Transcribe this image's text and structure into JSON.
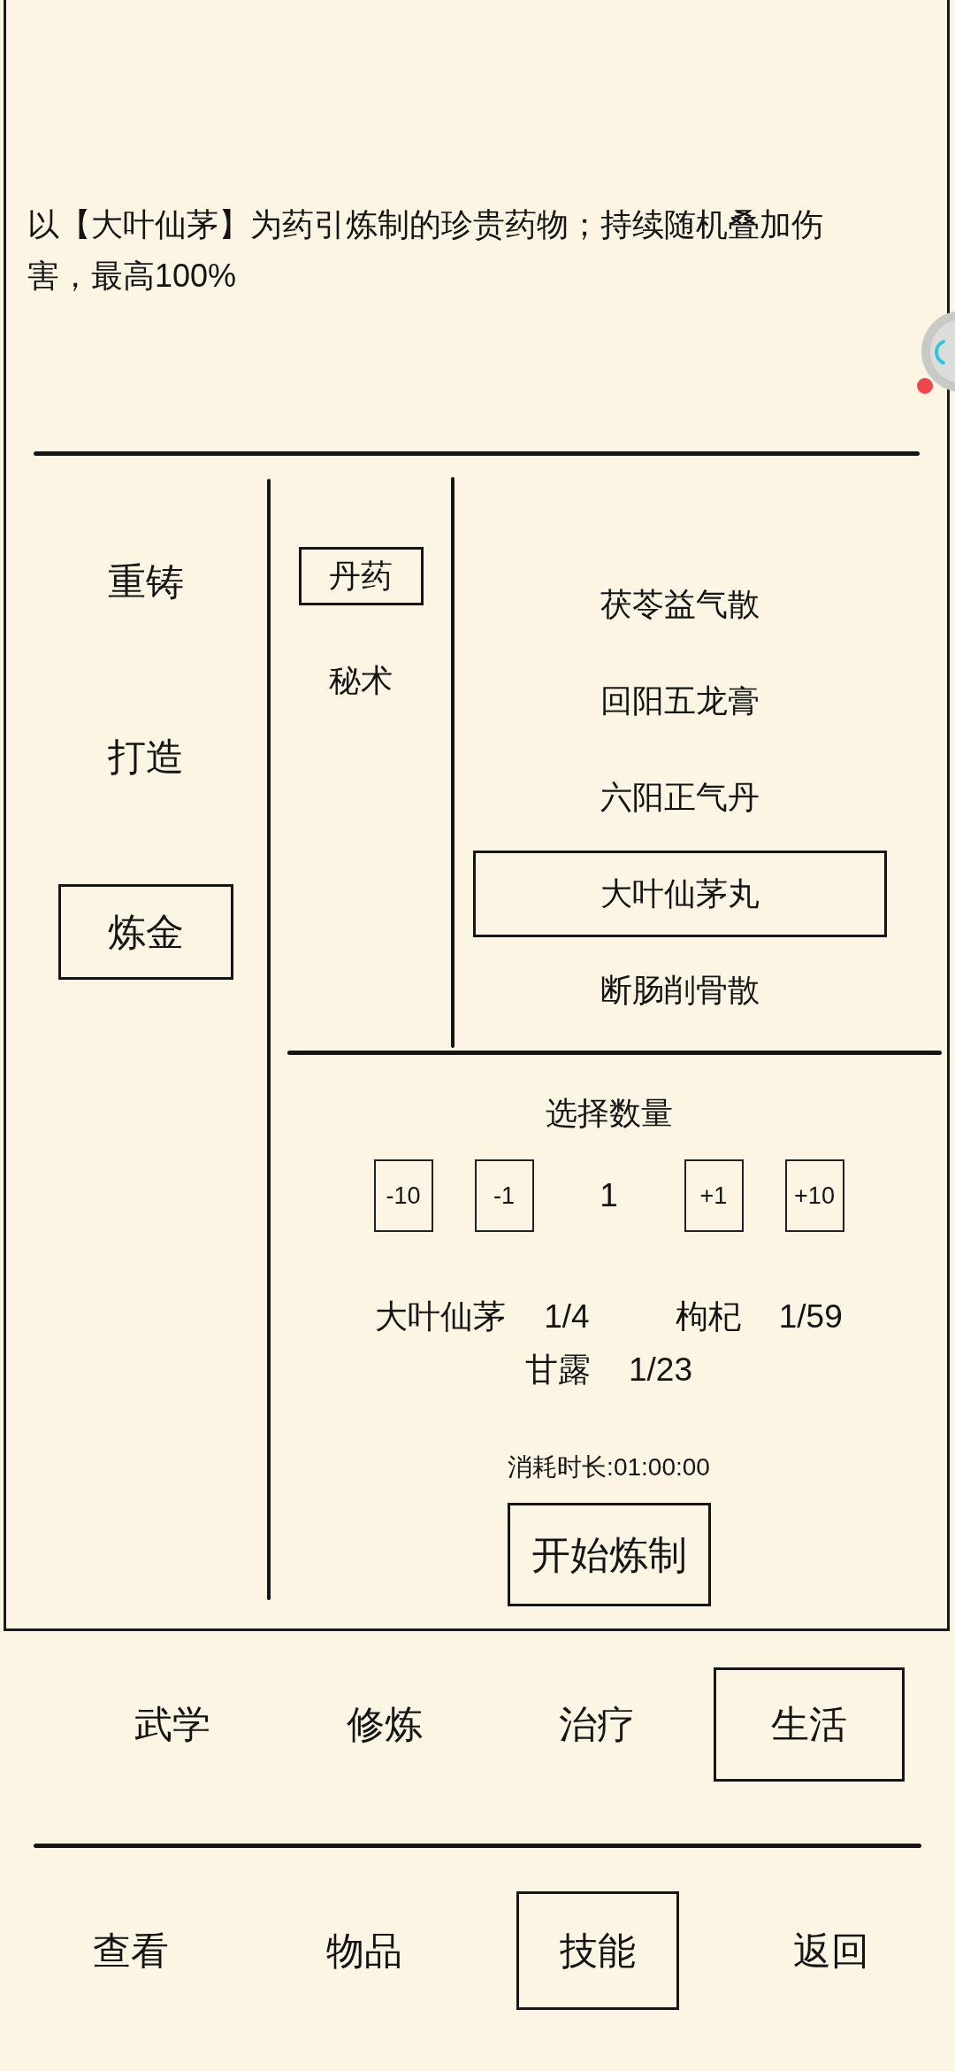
{
  "description": "以【大叶仙茅】为药引炼制的珍贵药物；持续随机叠加伤害，最高100%",
  "craft_menu": [
    {
      "label": "重铸",
      "selected": false
    },
    {
      "label": "打造",
      "selected": false
    },
    {
      "label": "炼金",
      "selected": true
    }
  ],
  "categories": [
    {
      "label": "丹药",
      "selected": true
    },
    {
      "label": "秘术",
      "selected": false
    }
  ],
  "recipes": [
    {
      "name": "茯苓益气散",
      "selected": false
    },
    {
      "name": "回阳五龙膏",
      "selected": false
    },
    {
      "name": "六阳正气丹",
      "selected": false
    },
    {
      "name": "大叶仙茅丸",
      "selected": true
    },
    {
      "name": "断肠削骨散",
      "selected": false
    }
  ],
  "quantity": {
    "title": "选择数量",
    "decrease_buttons": [
      "-10",
      "-1"
    ],
    "value": "1",
    "increase_buttons": [
      "+1",
      "+10"
    ]
  },
  "materials": [
    {
      "name": "大叶仙茅",
      "count": "1/4"
    },
    {
      "name": "枸杞",
      "count": "1/59"
    },
    {
      "name": "甘露",
      "count": "1/23"
    }
  ],
  "duration": "消耗时长:01:00:00",
  "start_button": "开始炼制",
  "skill_tabs": [
    {
      "label": "武学",
      "selected": false
    },
    {
      "label": "修炼",
      "selected": false
    },
    {
      "label": "治疗",
      "selected": false
    },
    {
      "label": "生活",
      "selected": true
    }
  ],
  "nav": [
    {
      "label": "查看",
      "selected": false
    },
    {
      "label": "物品",
      "selected": false
    },
    {
      "label": "技能",
      "selected": true
    },
    {
      "label": "返回",
      "selected": false
    }
  ]
}
